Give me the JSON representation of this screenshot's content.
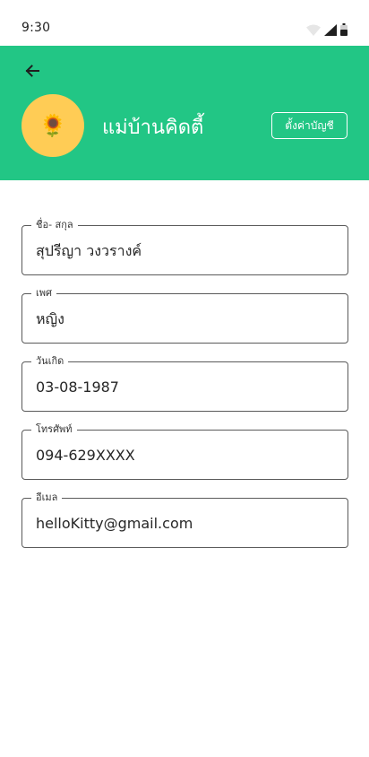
{
  "status_bar": {
    "time": "9:30",
    "icons": [
      "wifi-icon",
      "signal-icon",
      "battery-icon"
    ]
  },
  "header": {
    "back_icon": "arrow-left-icon",
    "avatar_icon": "sunflower-icon",
    "profile_name": "แม่บ้านคิดตี้",
    "settings_label": "ตั้งค่าบัญชี"
  },
  "form": {
    "fields": [
      {
        "label": "ชื่อ- สกุล",
        "value": "สุปรีญา วงวรางค์"
      },
      {
        "label": "เพศ",
        "value": "หญิง"
      },
      {
        "label": "วันเกิด",
        "value": "03-08-1987"
      },
      {
        "label": "โทรศัพท์",
        "value": "094-629XXXX"
      },
      {
        "label": "อีเมล",
        "value": "helloKitty@gmail.com"
      }
    ]
  },
  "colors": {
    "accent": "#22c685",
    "avatar_bg": "#ffcc55",
    "field_border": "#5a5a5a"
  }
}
